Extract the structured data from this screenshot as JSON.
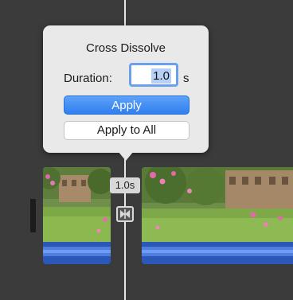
{
  "popover": {
    "title": "Cross Dissolve",
    "duration_label": "Duration:",
    "duration_value": "1.0",
    "duration_unit": "s",
    "apply_label": "Apply",
    "apply_all_label": "Apply to All"
  },
  "timeline": {
    "transition_duration_tag": "1.0s",
    "transition_icon": "transition-bowtie-icon"
  },
  "colors": {
    "accent": "#2f7ff0",
    "audio_track": "#2b58b8",
    "popover_bg": "#e9e9e9",
    "timeline_bg": "#3b3b3b"
  }
}
